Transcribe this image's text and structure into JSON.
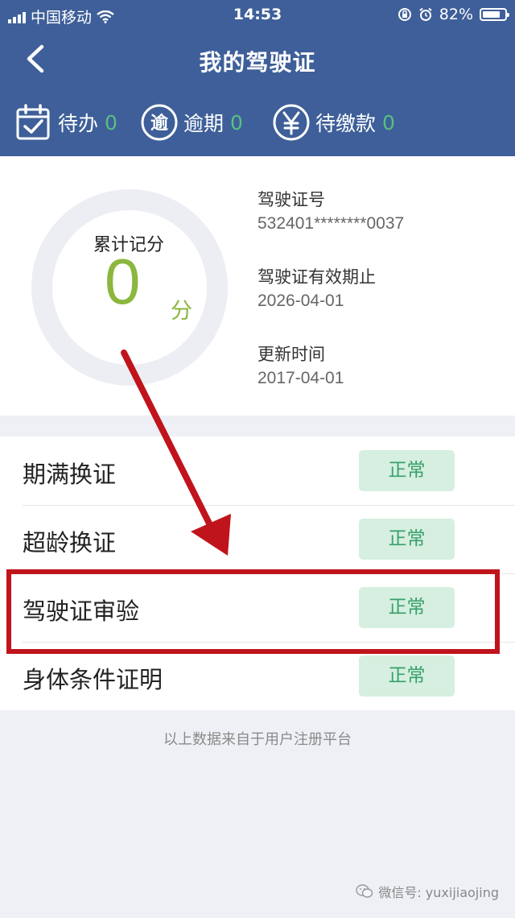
{
  "status_bar": {
    "carrier": "中国移动",
    "time": "14:53",
    "battery": "82%",
    "battery_level": 0.82
  },
  "nav": {
    "title": "我的驾驶证"
  },
  "tabs": [
    {
      "label": "待办",
      "count": "0",
      "icon": "calendar-check-icon"
    },
    {
      "label": "逾期",
      "count": "0",
      "icon": "overdue-icon"
    },
    {
      "label": "待缴款",
      "count": "0",
      "icon": "yuan-icon"
    }
  ],
  "score": {
    "label": "累计记分",
    "value": "0",
    "unit": "分"
  },
  "license": {
    "number_label": "驾驶证号",
    "number": "532401********0037",
    "expiry_label": "驾驶证有效期止",
    "expiry": "2026-04-01",
    "updated_label": "更新时间",
    "updated": "2017-04-01"
  },
  "status_list": [
    {
      "name": "期满换证",
      "status": "正常"
    },
    {
      "name": "超龄换证",
      "status": "正常"
    },
    {
      "name": "驾驶证审验",
      "status": "正常"
    },
    {
      "name": "身体条件证明",
      "status": "正常"
    }
  ],
  "footnote": "以上数据来自于用户注册平台",
  "watermark": "微信号: yuxijiaojing",
  "colors": {
    "header": "#3e5f99",
    "score_green": "#8bb73e",
    "badge_bg": "#d6efe0",
    "badge_text": "#37a06a",
    "annotation_red": "#c0141c"
  }
}
